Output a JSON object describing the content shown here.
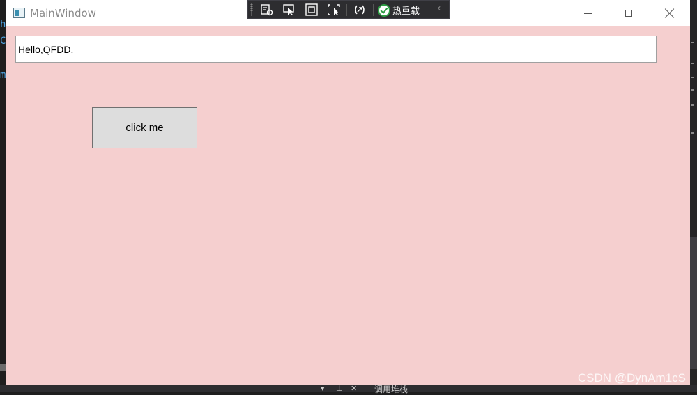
{
  "window": {
    "title": "MainWindow"
  },
  "debug_toolbar": {
    "hot_reload_label": "热重载"
  },
  "main": {
    "textbox_value": "Hello,QFDD.",
    "button_label": "click me"
  },
  "watermark": "CSDN @DynAm1cS",
  "background": {
    "left_glyphs": [
      "h",
      "C",
      "m"
    ],
    "bottom_panel_label": "调用堆栈"
  },
  "colors": {
    "window_background": "#f5cfcf",
    "hot_reload_check": "#2e9e44",
    "button_background": "#dddddd"
  }
}
